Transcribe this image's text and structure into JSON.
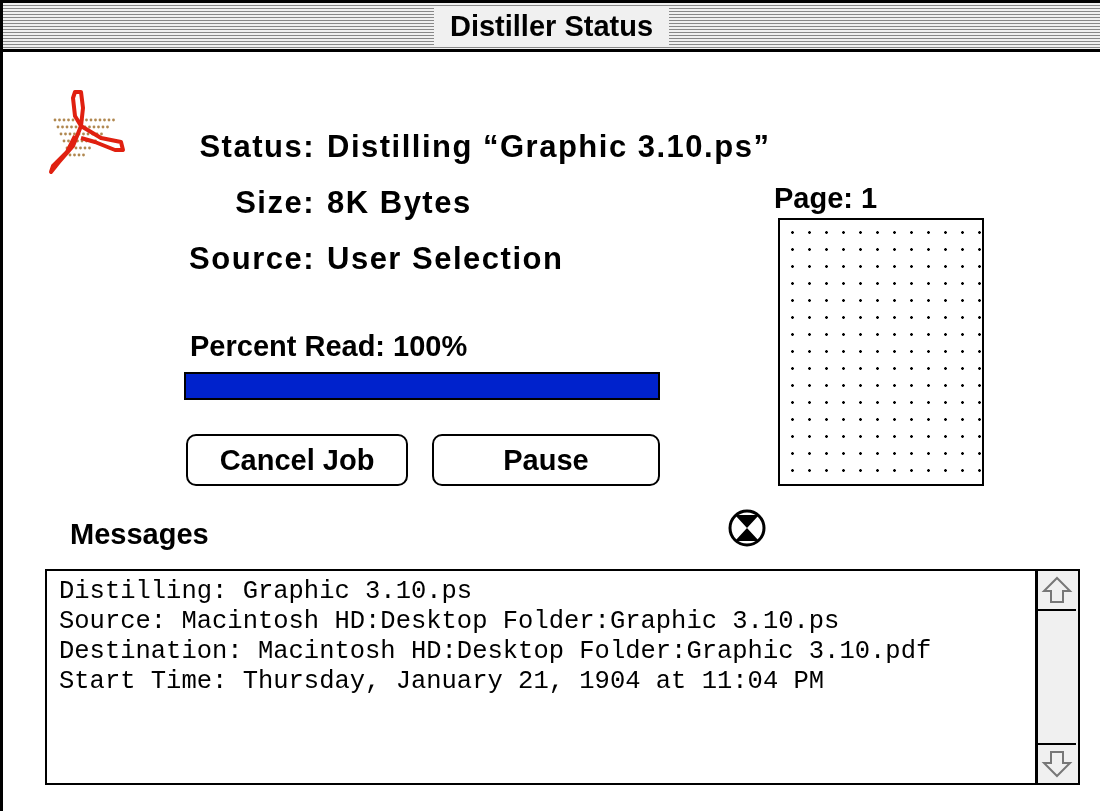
{
  "window": {
    "title": "Distiller Status"
  },
  "fields": [
    {
      "label": "Status:",
      "value": "Distilling “Graphic 3.10.ps”"
    },
    {
      "label": "Size:",
      "value": "8K Bytes"
    },
    {
      "label": "Source:",
      "value": "User Selection"
    }
  ],
  "page": {
    "label": "Page: 1"
  },
  "progress": {
    "label": "Percent Read: 100%",
    "level": 1
  },
  "buttons": [
    "Cancel Job",
    "Pause"
  ],
  "messages": {
    "title": "Messages",
    "lines": [
      "Distilling: Graphic 3.10.ps",
      "Source: Macintosh HD:Desktop Folder:Graphic 3.10.ps",
      "Destination: Macintosh HD:Desktop Folder:Graphic 3.10.pdf",
      "Start Time: Thursday, January 21, 1904 at 11:04 PM"
    ]
  }
}
